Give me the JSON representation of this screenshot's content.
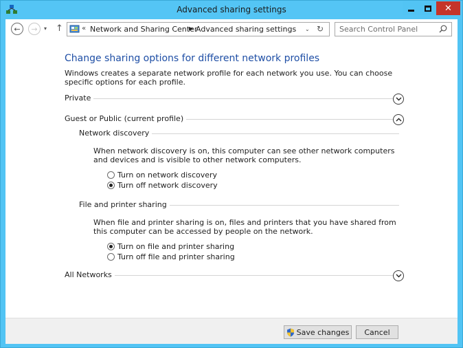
{
  "window": {
    "title": "Advanced sharing settings"
  },
  "titlebar": {
    "minimize_glyph": "–",
    "maximize_glyph": "□",
    "close_glyph": "✕"
  },
  "nav": {
    "back_glyph": "←",
    "forward_glyph": "→",
    "recent_glyph": "▾",
    "up_glyph": "↑",
    "address": {
      "overflow_glyph": "«",
      "breadcrumbs": [
        "Network and Sharing Center",
        "Advanced sharing settings"
      ],
      "separator_glyph": "▶",
      "dropdown_glyph": "⌄",
      "refresh_glyph": "↻"
    },
    "search": {
      "placeholder": "Search Control Panel"
    }
  },
  "content": {
    "title": "Change sharing options for different network profiles",
    "description": "Windows creates a separate network profile for each network you use. You can choose specific options for each profile.",
    "profiles": [
      {
        "label": "Private",
        "expanded": false
      },
      {
        "label": "Guest or Public (current profile)",
        "expanded": true
      },
      {
        "label": "All Networks",
        "expanded": false
      }
    ],
    "network_discovery": {
      "heading": "Network discovery",
      "description": "When network discovery is on, this computer can see other network computers and devices and is visible to other network computers.",
      "options": [
        {
          "label": "Turn on network discovery",
          "checked": false
        },
        {
          "label": "Turn off network discovery",
          "checked": true
        }
      ]
    },
    "file_printer_sharing": {
      "heading": "File and printer sharing",
      "description": "When file and printer sharing is on, files and printers that you have shared from this computer can be accessed by people on the network.",
      "options": [
        {
          "label": "Turn on file and printer sharing",
          "checked": true
        },
        {
          "label": "Turn off file and printer sharing",
          "checked": false
        }
      ]
    }
  },
  "footer": {
    "save_label": "Save changes",
    "cancel_label": "Cancel"
  },
  "colors": {
    "titlebar": "#54c5f5",
    "close_button": "#c5342a",
    "heading_blue": "#1e4ea5"
  }
}
